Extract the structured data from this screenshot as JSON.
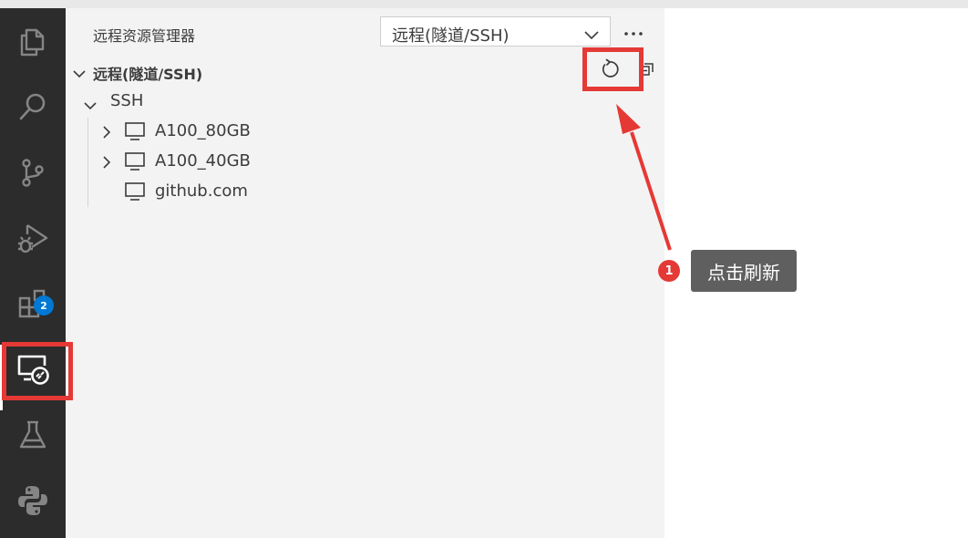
{
  "activity_bar": {
    "items": [
      {
        "name": "explorer",
        "icon": "files-icon"
      },
      {
        "name": "search",
        "icon": "search-icon"
      },
      {
        "name": "source-control",
        "icon": "source-control-icon"
      },
      {
        "name": "run-debug",
        "icon": "run-debug-icon"
      },
      {
        "name": "extensions",
        "icon": "extensions-icon",
        "badge": "2"
      },
      {
        "name": "remote-explorer",
        "icon": "remote-explorer-icon",
        "active": true
      },
      {
        "name": "testing",
        "icon": "flask-icon"
      },
      {
        "name": "python",
        "icon": "python-icon"
      }
    ]
  },
  "sidebar": {
    "title": "远程资源管理器",
    "dropdown_value": "远程(隧道/SSH)",
    "more_icon": "ellipsis-icon",
    "section": {
      "title": "远程(隧道/SSH)",
      "actions": [
        {
          "name": "refresh",
          "icon": "refresh-icon"
        },
        {
          "name": "collapse-all",
          "icon": "collapse-all-icon"
        }
      ],
      "group": {
        "label": "SSH",
        "hosts": [
          {
            "label": "A100_80GB",
            "expandable": true
          },
          {
            "label": "A100_40GB",
            "expandable": true
          },
          {
            "label": "github.com",
            "expandable": false
          }
        ]
      }
    }
  },
  "annotation": {
    "step_number": "1",
    "text": "点击刷新",
    "color": "#e53935"
  },
  "colors": {
    "activity_bar_bg": "#2c2c2c",
    "sidebar_bg": "#f3f3f3",
    "badge": "#0078d4",
    "highlight": "#e53935",
    "tooltip_bg": "#5f5f5f"
  }
}
